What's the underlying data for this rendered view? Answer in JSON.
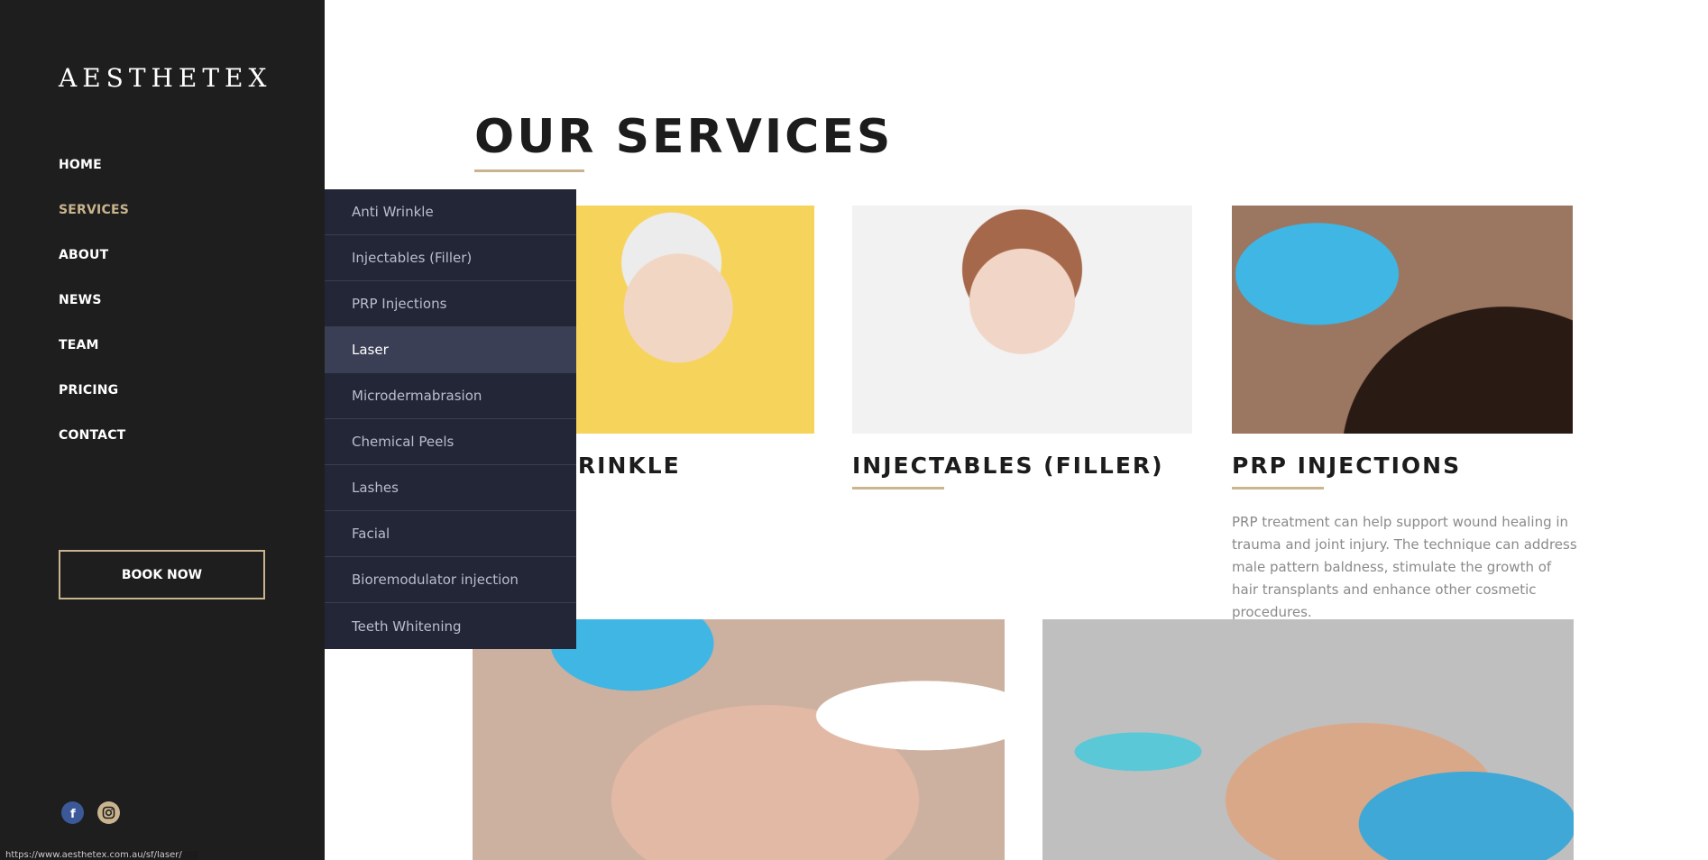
{
  "brand": {
    "logo": "AESTHETEX"
  },
  "nav": [
    {
      "label": "HOME"
    },
    {
      "label": "SERVICES"
    },
    {
      "label": "ABOUT"
    },
    {
      "label": "NEWS"
    },
    {
      "label": "TEAM"
    },
    {
      "label": "PRICING"
    },
    {
      "label": "CONTACT"
    }
  ],
  "book_button": "BOOK NOW",
  "social": {
    "facebook_icon": "facebook-icon",
    "instagram_icon": "instagram-icon"
  },
  "status_bar_url": "https://www.aesthetex.com.au/sf/laser/",
  "dropdown": [
    {
      "label": "Anti Wrinkle"
    },
    {
      "label": "Injectables (Filler)"
    },
    {
      "label": "PRP Injections"
    },
    {
      "label": "Laser"
    },
    {
      "label": "Microdermabrasion"
    },
    {
      "label": "Chemical Peels"
    },
    {
      "label": "Lashes"
    },
    {
      "label": "Facial"
    },
    {
      "label": "Bioremodulator injection"
    },
    {
      "label": "Teeth Whitening"
    }
  ],
  "main": {
    "heading": "OUR SERVICES",
    "cards": [
      {
        "title": "ANTI WRINKLE"
      },
      {
        "title": "INJECTABLES (FILLER)"
      },
      {
        "title": "PRP INJECTIONS",
        "description": "PRP treatment can help support wound healing in trauma and joint injury. The technique can address male pattern baldness, stimulate the growth of hair transplants and enhance other cosmetic procedures."
      }
    ]
  },
  "colors": {
    "sidebar": "#1e1e1e",
    "accent": "#c9b48e",
    "dropdown": "#232636",
    "dropdown_hover": "#3b3f55"
  }
}
